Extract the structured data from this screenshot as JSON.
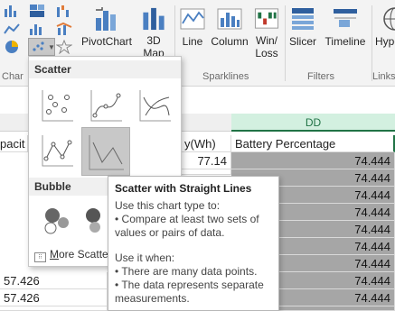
{
  "ribbon": {
    "pivotchart_label": "PivotChart",
    "map3d_label": "3D",
    "map3d_sub": "Map",
    "line_label": "Line",
    "column_label": "Column",
    "winloss_label": "Win/",
    "winloss_sub": "Loss",
    "slicer_label": "Slicer",
    "timeline_label": "Timeline",
    "hyperlink_label": "Hyperlin",
    "group_charts": "Char",
    "group_sparklines": "Sparklines",
    "group_filters": "Filters",
    "group_links": "Links"
  },
  "menu": {
    "section_scatter": "Scatter",
    "section_bubble": "Bubble",
    "more_link_u": "M",
    "more_link_rest": "ore Scatte"
  },
  "tooltip": {
    "title": "Scatter with Straight Lines",
    "line1": "Use this chart type to:",
    "line2": "• Compare at least two sets of values or pairs of data.",
    "line3": "Use it when:",
    "line4": "• There are many data points.",
    "line5": "• The data represents separate measurements."
  },
  "sheet": {
    "col_dd": "DD",
    "hdr_capacity": "pacit",
    "hdr_wh": "y(Wh)",
    "hdr_battery": "Battery Percentage",
    "wh_values": [
      "77.14",
      "77.14"
    ],
    "battery_values": [
      "74.444",
      "74.444",
      "74.444",
      "74.444",
      "74.444",
      "74.444",
      "74.444",
      "74.444",
      "74.444",
      "74.444"
    ],
    "left_values": [
      "57.426",
      "57.426",
      "57.426"
    ]
  },
  "colors": {
    "excel_green": "#217346",
    "selection_grey": "#a6a6a6"
  }
}
